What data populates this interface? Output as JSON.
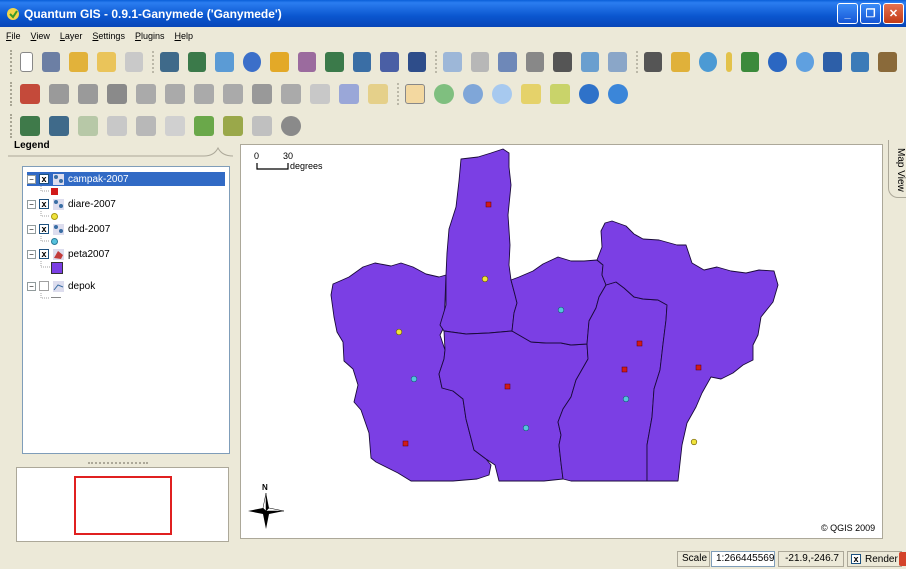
{
  "window": {
    "title": "Quantum GIS - 0.9.1-Ganymede ('Ganymede')"
  },
  "menu": [
    "File",
    "View",
    "Layer",
    "Settings",
    "Plugins",
    "Help"
  ],
  "legend": {
    "title": "Legend",
    "layers": [
      {
        "name": "campak-2007",
        "checked": "x",
        "expand": "−",
        "selected": true,
        "symbol_color": "#d11a1a"
      },
      {
        "name": "diare-2007",
        "checked": "x",
        "expand": "−",
        "selected": false,
        "symbol_color": "#f0e33c"
      },
      {
        "name": "dbd-2007",
        "checked": "x",
        "expand": "−",
        "selected": false,
        "symbol_color": "#56c3de"
      },
      {
        "name": "peta2007",
        "checked": "x",
        "expand": "−",
        "selected": false,
        "symbol_color": "#7b3fe4"
      },
      {
        "name": "depok",
        "checked": "",
        "expand": "−",
        "selected": false,
        "symbol_color": "#aaaaaa"
      }
    ]
  },
  "map": {
    "scale_bar": {
      "zero": "0",
      "value": "30",
      "unit": "degrees"
    },
    "north_label": "N",
    "copyright": "© QGIS 2009",
    "fill_color": "#7b3fe4",
    "side_tab": "Map View"
  },
  "status": {
    "scale_label": "Scale",
    "scale_value": "1:266445569",
    "coords": "-21.9,-246.7",
    "render_label": "Render",
    "render_checked": "x"
  }
}
